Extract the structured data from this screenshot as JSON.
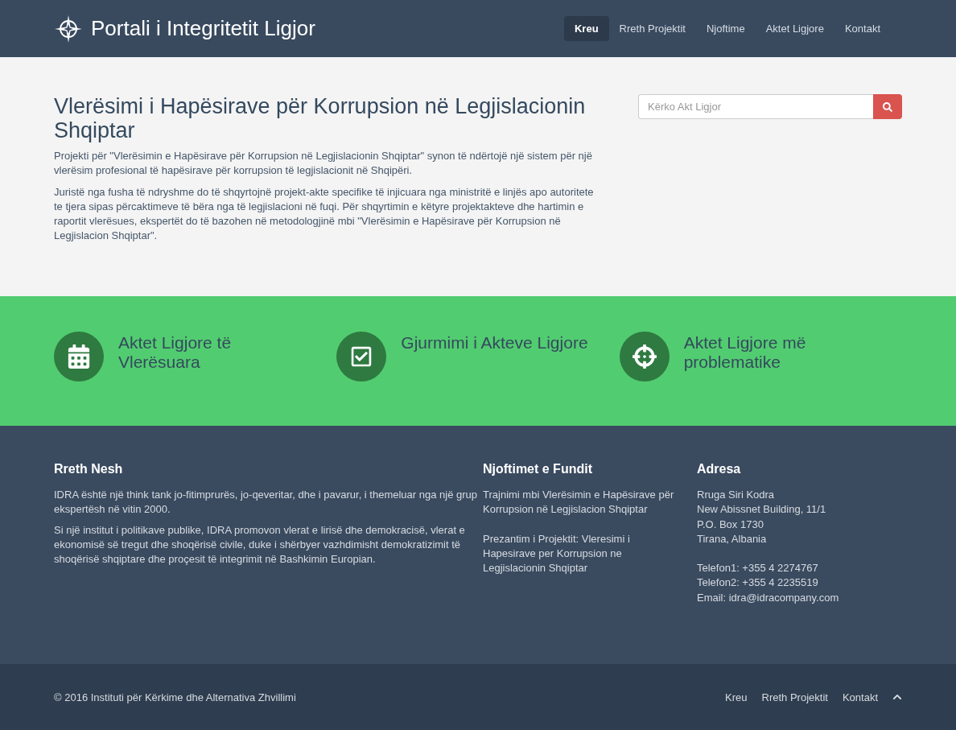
{
  "header": {
    "brand": "Portali i Integritetit Ligjor",
    "nav": [
      {
        "label": "Kreu",
        "selected": true
      },
      {
        "label": "Rreth Projektit",
        "selected": false
      },
      {
        "label": "Njoftime",
        "selected": false
      },
      {
        "label": "Aktet Ligjore",
        "selected": false
      },
      {
        "label": "Kontakt",
        "selected": false
      }
    ]
  },
  "hero": {
    "title": "Vlerësimi i Hapësirave për Korrupsion në Legjislacionin Shqiptar",
    "paragraphs": [
      "Projekti për \"Vlerësimin e Hapësirave për Korrupsion në Legjislacionin Shqiptar\" synon të ndërtojë një sistem për një vlerësim profesional të hapësirave për korrupsion të legjislacionit në Shqipëri.",
      "Juristë nga fusha të ndryshme do të shqyrtojnë projekt-akte specifike të injicuara nga ministritë e linjës apo autoritete te tjera sipas përcaktimeve të bëra nga të legjislacioni në fuqi. Për shqyrtimin e këtyre projektakteve dhe hartimin e raportit vlerësues, ekspertët do të bazohen në metodologjinë mbi \"Vlerësimin e Hapësirave për Korrupsion në Legjislacion Shqiptar\"."
    ],
    "search": {
      "placeholder": "Kërko Akt Ligjor"
    }
  },
  "features": [
    {
      "kind": "calendar",
      "label": "Aktet Ligjore të Vlerësuara"
    },
    {
      "kind": "check",
      "label": "Gjurmimi i Akteve Ligjore"
    },
    {
      "kind": "target",
      "label": "Aktet Ligjore më problematike"
    }
  ],
  "footer": {
    "about": {
      "title": "Rreth Nesh",
      "paragraphs": [
        "IDRA është një think tank jo-fitimprurës, jo-qeveritar, dhe i pavarur, i themeluar nga një grup ekspertësh në vitin 2000.",
        "Si një institut i politikave publike, IDRA promovon vlerat e lirisë dhe demokracisë, vlerat e ekonomisë së tregut dhe shoqërisë civile, duke i shërbyer vazhdimisht demokratizimit të shoqërisë shqiptare dhe proçesit të integrimit në Bashkimin Europian."
      ]
    },
    "news": {
      "title": "Njoftimet e Fundit",
      "items": [
        "Trajnimi mbi Vlerësimin e Hapësirave për Korrupsion në Legjislacion Shqiptar",
        "Prezantim i Projektit: Vleresimi i Hapesirave per Korrupsion ne Legjislacionin Shqiptar"
      ]
    },
    "address": {
      "title": "Adresa",
      "groups": [
        [
          "Rruga Siri Kodra",
          "New Abissnet Building, 11/1",
          "P.O. Box 1730",
          "Tirana, Albania"
        ],
        [
          "Telefon1: +355 4 2274767",
          "Telefon2: +355 4 2235519",
          "Email: idra@idracompany.com"
        ]
      ]
    }
  },
  "bottom": {
    "copyright": "© 2016 Instituti për Kërkime dhe Alternativa Zhvillimi",
    "links": [
      "Kreu",
      "Rreth Projektit",
      "Kontakt"
    ]
  }
}
